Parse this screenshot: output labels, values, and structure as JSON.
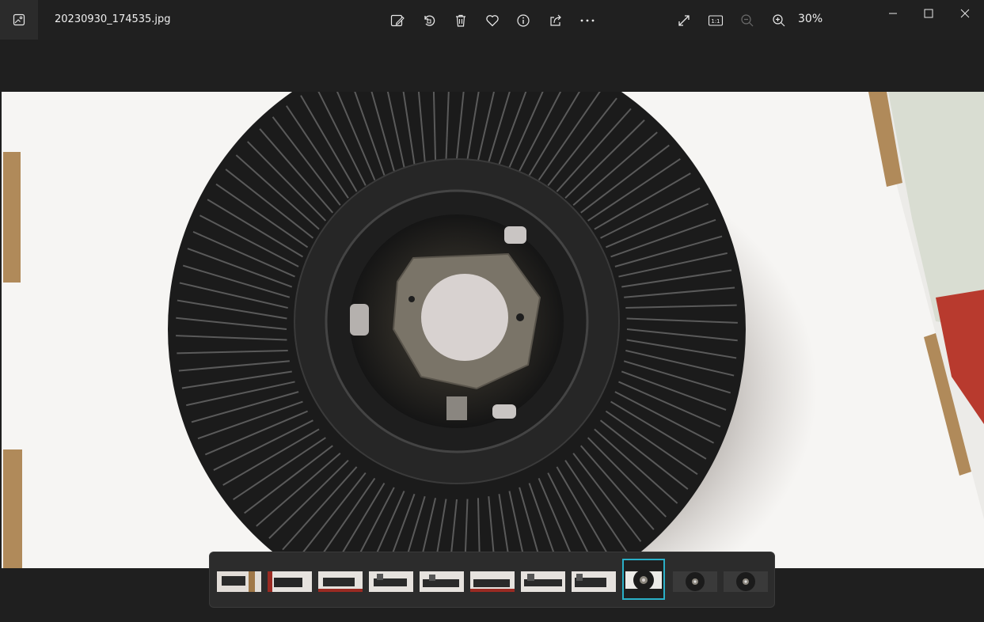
{
  "titlebar": {
    "filename": "20230930_174535.jpg",
    "zoom_level": "30%",
    "icons": {
      "app": "photos-app-icon",
      "edit": "edit-image-icon",
      "rotate": "rotate-icon",
      "delete": "trash-icon",
      "favorite": "heart-icon",
      "info": "info-icon",
      "share": "share-icon",
      "more": "more-icon",
      "fullscreen": "fullscreen-icon",
      "actual_size": "actual-size-icon",
      "zoom_out": "zoom-out-icon",
      "zoom_in": "zoom-in-icon"
    },
    "actual_size_label": "1:1"
  },
  "window_controls": [
    "minimize",
    "maximize",
    "close"
  ],
  "filmstrip": {
    "thumbnail_count": 11,
    "selected_index": 8
  },
  "colors": {
    "background": "#1f1f1f",
    "titlebar": "#202020",
    "selection_accent": "#2ab0c8"
  }
}
